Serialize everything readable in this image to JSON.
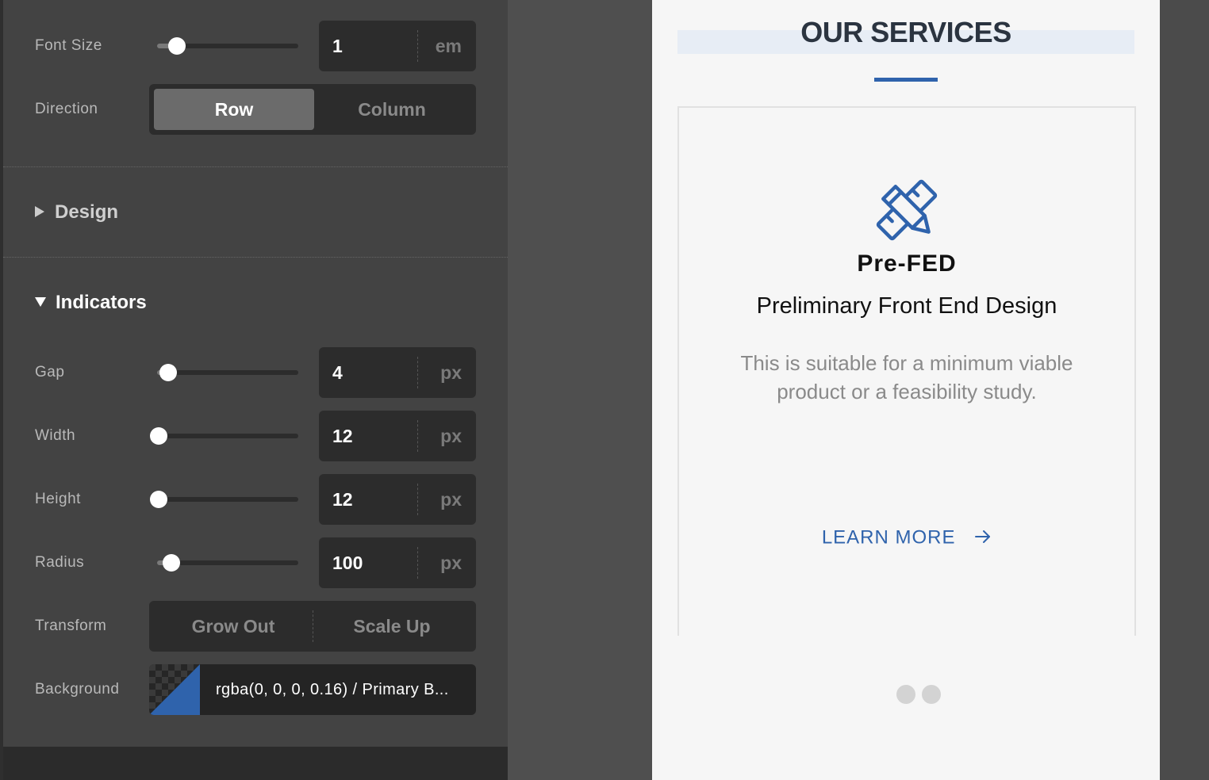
{
  "colors": {
    "panel_bg": "#434343",
    "field_bg": "#2c2c2c",
    "accent_blue": "#2f63ac",
    "preview_bg": "#f6f6f6"
  },
  "panel": {
    "font_size": {
      "label": "Font Size",
      "value": "1",
      "unit": "em",
      "slider_fraction": 0.14
    },
    "direction": {
      "label": "Direction",
      "options": [
        "Row",
        "Column"
      ],
      "selected": "Row"
    },
    "design_section": {
      "label": "Design",
      "expanded": false
    },
    "indicators_section": {
      "label": "Indicators",
      "expanded": true
    },
    "gap": {
      "label": "Gap",
      "value": "4",
      "unit": "px",
      "slider_fraction": 0.08
    },
    "width": {
      "label": "Width",
      "value": "12",
      "unit": "px",
      "slider_fraction": 0.02
    },
    "height": {
      "label": "Height",
      "value": "12",
      "unit": "px",
      "slider_fraction": 0.02
    },
    "radius": {
      "label": "Radius",
      "value": "100",
      "unit": "px",
      "slider_fraction": 0.1
    },
    "transform": {
      "label": "Transform",
      "options": [
        "Grow Out",
        "Scale Up"
      ],
      "selected": ""
    },
    "background": {
      "label": "Background",
      "value": "rgba(0, 0, 0, 0.16) / Primary B...",
      "swatch_color": "#2f63ac"
    }
  },
  "preview": {
    "heading": "OUR SERVICES",
    "card": {
      "icon": "pencil-ruler-icon",
      "title": "Pre-FED",
      "subtitle": "Preliminary Front End Design",
      "description": "This is suitable for a minimum viable product or a feasibility study.",
      "link_label": "LEARN MORE",
      "link_icon": "arrow-right-icon"
    },
    "pagination_dots": 2
  }
}
